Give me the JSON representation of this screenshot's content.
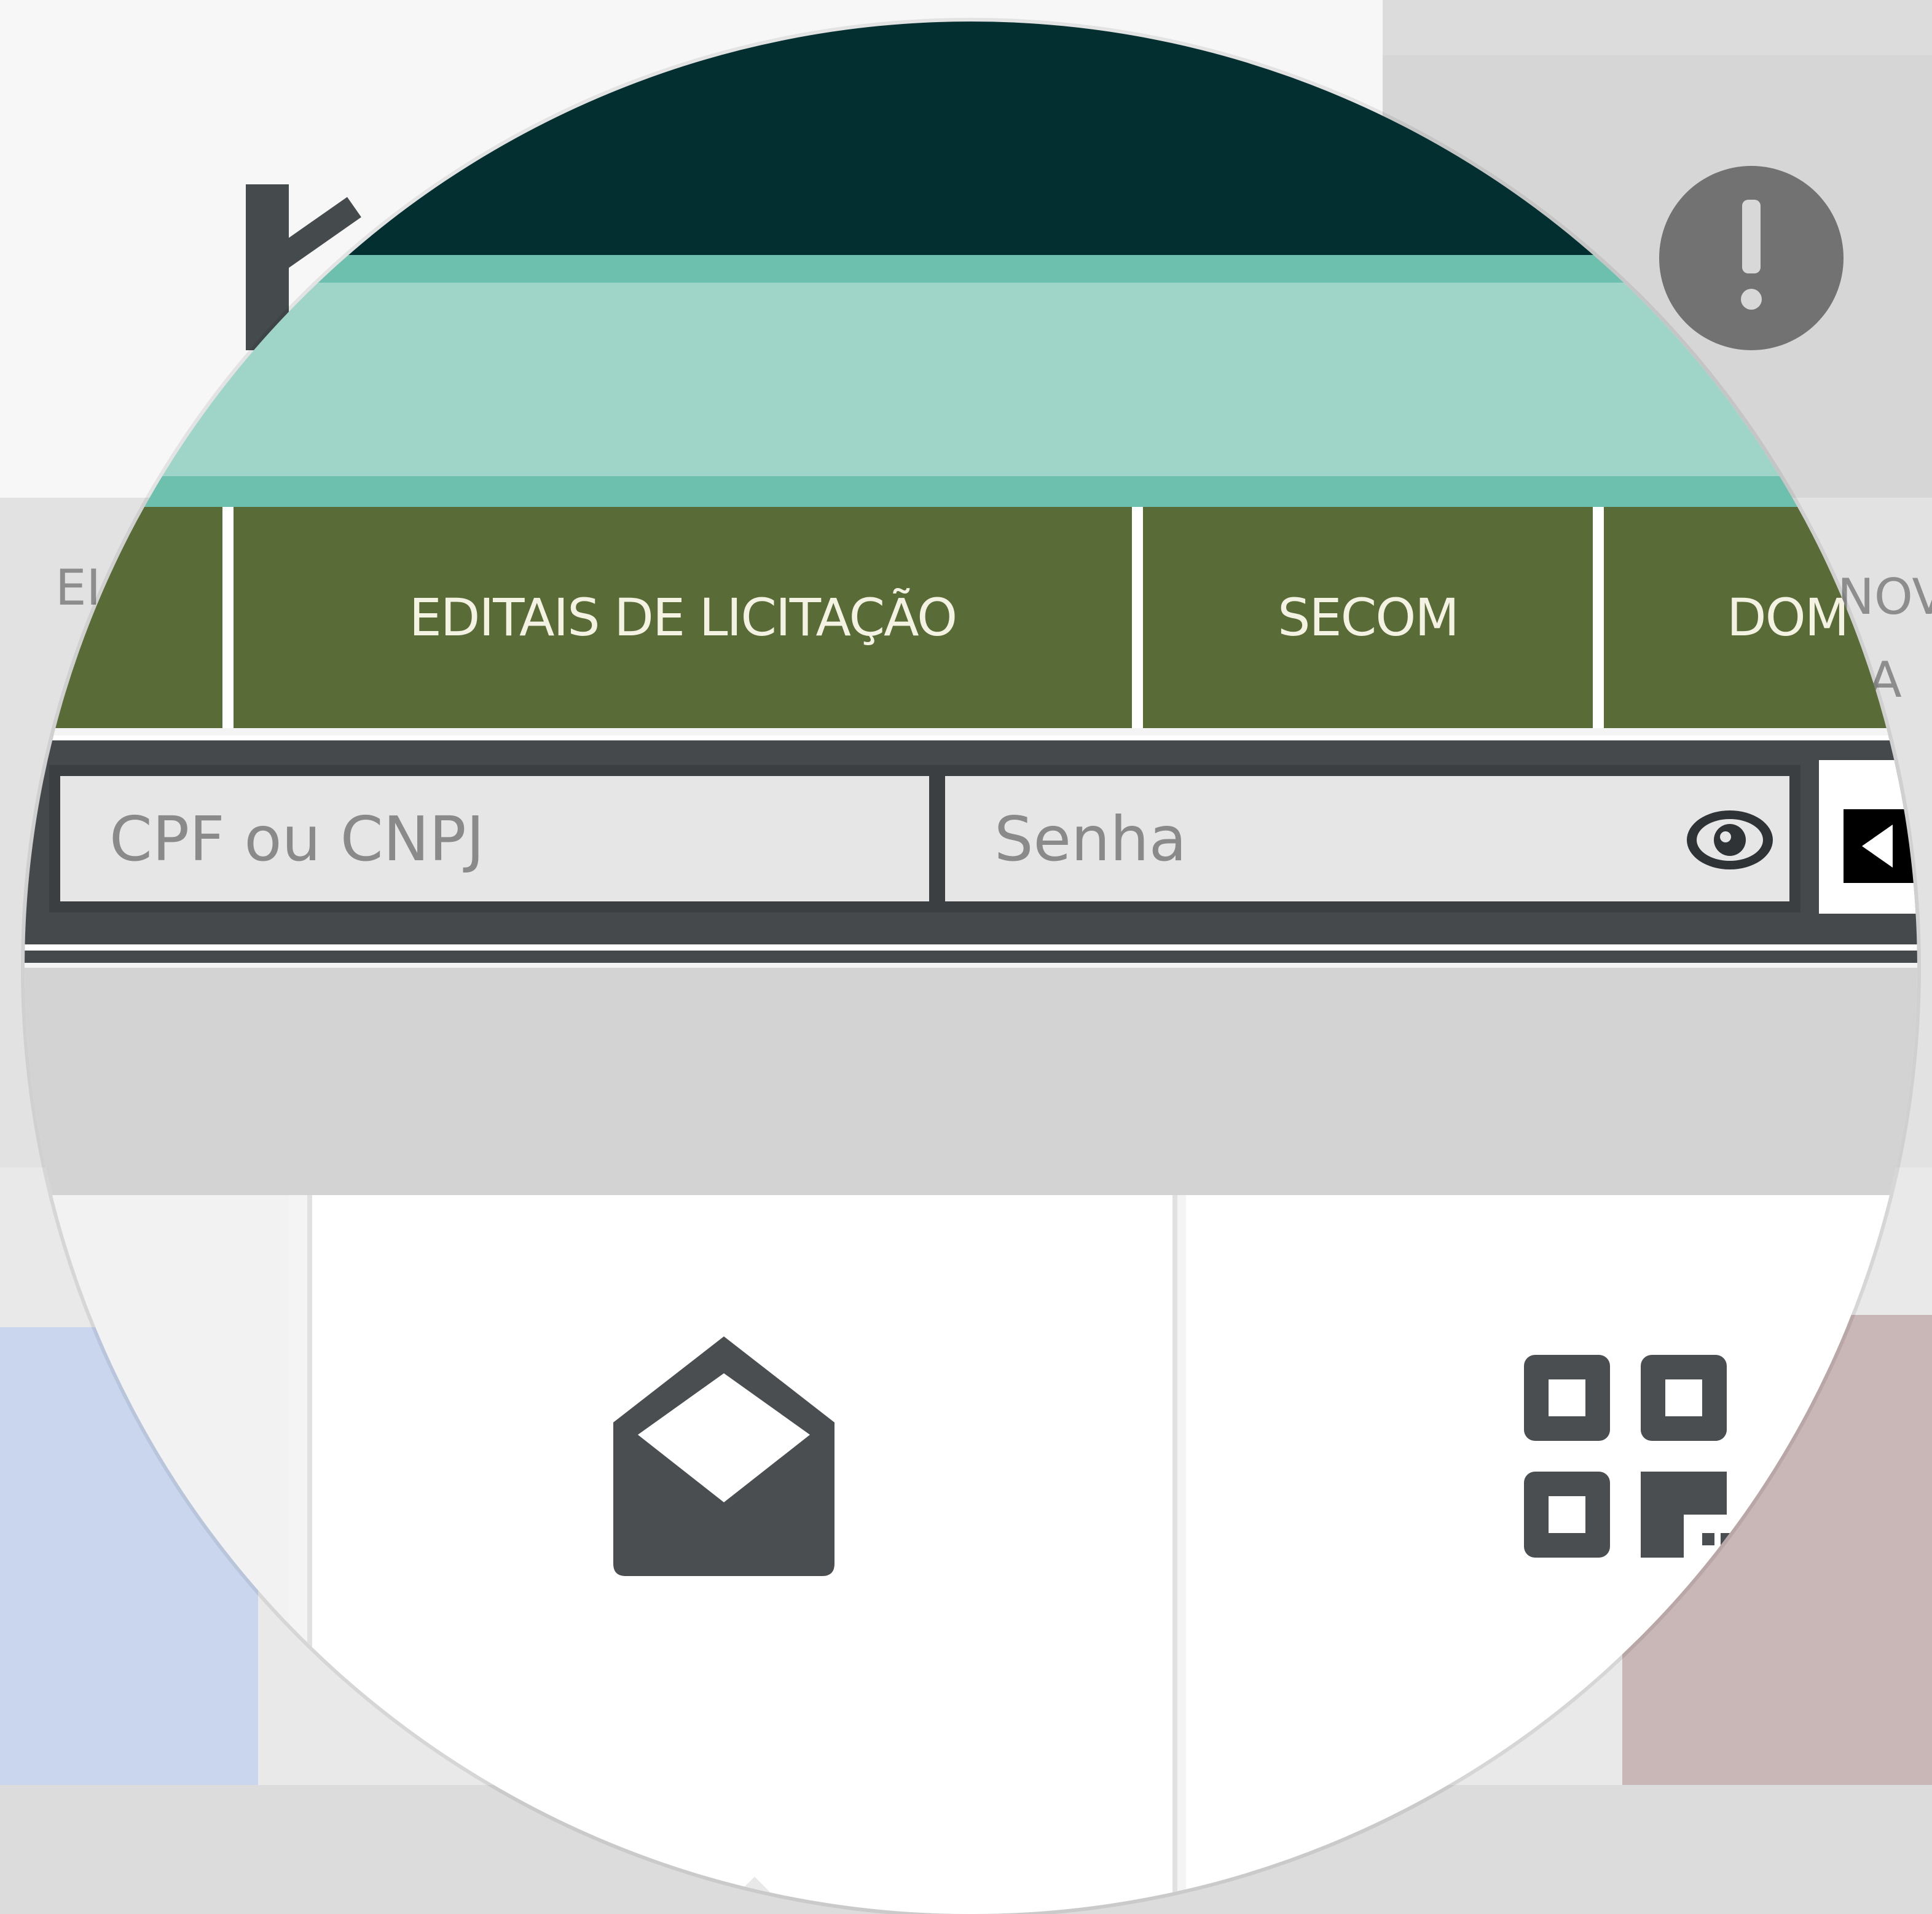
{
  "colors": {
    "header_dark": "#042f30",
    "band_teal": "#6cc0ad",
    "band_light": "#9ed5c8",
    "nav_bg": "#596b36",
    "nav_text": "#f4f2e2",
    "login_bar": "#46494c",
    "input_bg": "#e6e6e6"
  },
  "nav": {
    "items": [
      {
        "label": "E"
      },
      {
        "label": "EDITAIS DE LICITAÇÃO"
      },
      {
        "label": "SECOM"
      },
      {
        "label": "DOM"
      }
    ]
  },
  "login": {
    "cpf_placeholder": "CPF ou CNPJ",
    "password_placeholder": "Senha"
  },
  "background_fragments": {
    "left_nav": "EI",
    "right_nav_1": "NOV",
    "right_nav_2": "A"
  },
  "icons": {
    "alert": "alert-circle-icon",
    "eye": "eye-icon",
    "submit": "arrow-left-icon",
    "mail": "mail-open-icon",
    "qr": "qr-code-icon"
  }
}
